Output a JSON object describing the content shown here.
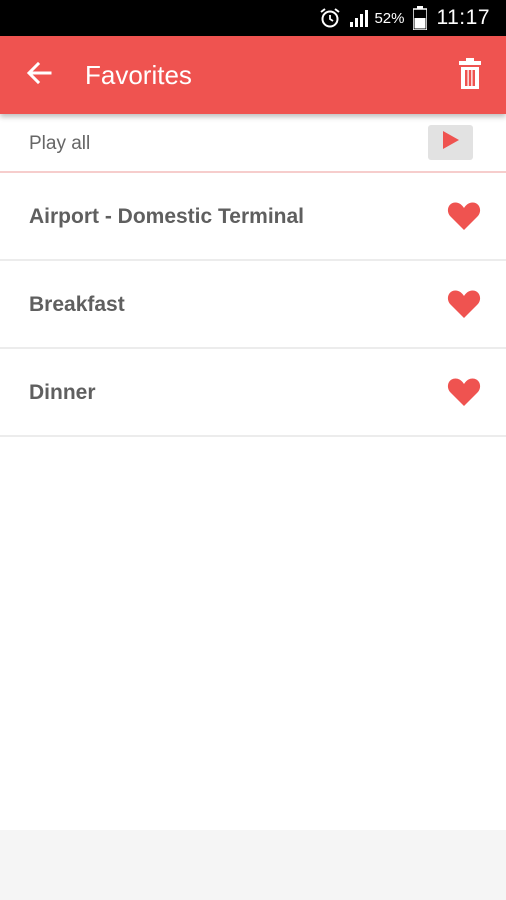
{
  "status_bar": {
    "battery_percent": "52%",
    "time": "11:17",
    "icons": [
      "alarm-icon",
      "signal-icon",
      "battery-icon"
    ]
  },
  "app_bar": {
    "title": "Favorites",
    "back_icon": "arrow-left-icon",
    "delete_icon": "trash-icon",
    "background_color": "#ef5350"
  },
  "play_all": {
    "label": "Play all",
    "button_icon": "play-icon"
  },
  "favorites": [
    {
      "label": "Airport - Domestic Terminal",
      "icon": "heart-icon"
    },
    {
      "label": "Breakfast",
      "icon": "heart-icon"
    },
    {
      "label": "Dinner",
      "icon": "heart-icon"
    }
  ],
  "colors": {
    "accent": "#ef5350",
    "text": "#5f5f5f"
  }
}
